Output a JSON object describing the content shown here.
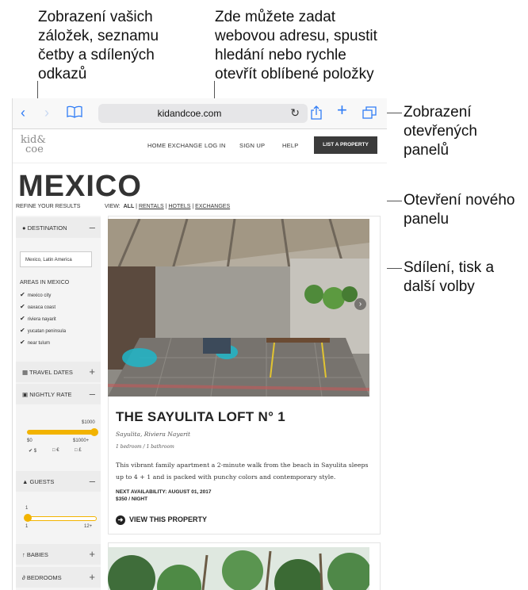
{
  "callouts": {
    "bookmarks": "Zobrazení vašich\nzáložek, seznamu\nčetby a sdílených\nodkazů",
    "address": "Zde můžete zadat\nwebovou adresu, spustit\nhledání nebo rychle\notevřít oblíbené položky",
    "tabs": "Zobrazení\notevřených\npanelů",
    "new_tab": "Otevření nového\npanelu",
    "share": "Sdílení, tisk a\ndalší volby"
  },
  "browser": {
    "url": "kidandcoe.com",
    "icons": {
      "back": "chevron-left-icon",
      "forward": "chevron-right-icon",
      "bookmarks": "book-icon",
      "reload": "reload-icon",
      "share": "share-icon",
      "new_tab": "plus-icon",
      "tabs": "tabs-icon"
    },
    "accent_color": "#2f7cf6"
  },
  "site": {
    "logo_line1": "kid&",
    "logo_line2": "coe",
    "nav": [
      "HOME EXCHANGE",
      "LOG IN",
      "SIGN UP",
      "HELP"
    ],
    "list_button": "LIST A PROPERTY",
    "page_title": "MEXICO",
    "refine": "REFINE YOUR RESULTS",
    "view_label": "VIEW:",
    "view_all": "ALL",
    "view_links": [
      "RENTALS",
      "HOTELS",
      "EXCHANGES"
    ],
    "sidebar": {
      "destination": "DESTINATION",
      "destination_value": "Mexico, Latin America",
      "areas_title": "AREAS IN MEXICO",
      "areas": [
        "mexico city",
        "oaxaca coast",
        "riviera nayarit",
        "yucatan peninsula",
        "near tulum"
      ],
      "travel_dates": "TRAVEL DATES",
      "nightly_rate": "NIGHTLY RATE",
      "rate_max_label": "$1000",
      "rate_min": "$0",
      "rate_max": "$1000+",
      "currencies": [
        "$",
        "€",
        "£"
      ],
      "guests": "GUESTS",
      "guests_value": "1",
      "guests_min": "1",
      "guests_max": "12+",
      "babies": "BABIES",
      "bedrooms": "BEDROOMS"
    },
    "listing": {
      "title": "THE SAYULITA LOFT N° 1",
      "location": "Sayulita, Riviera Nayarit",
      "beds": "1 bedroom / 1 bathroom",
      "description": "This vibrant family apartment a 2-minute walk from the beach in Sayulita sleeps up to 4 + 1 and is packed with punchy colors and contemporary style.",
      "availability": "NEXT AVAILABILITY: AUGUST 01, 2017",
      "price": "$350 / NIGHT",
      "cta": "VIEW THIS PROPERTY"
    }
  }
}
